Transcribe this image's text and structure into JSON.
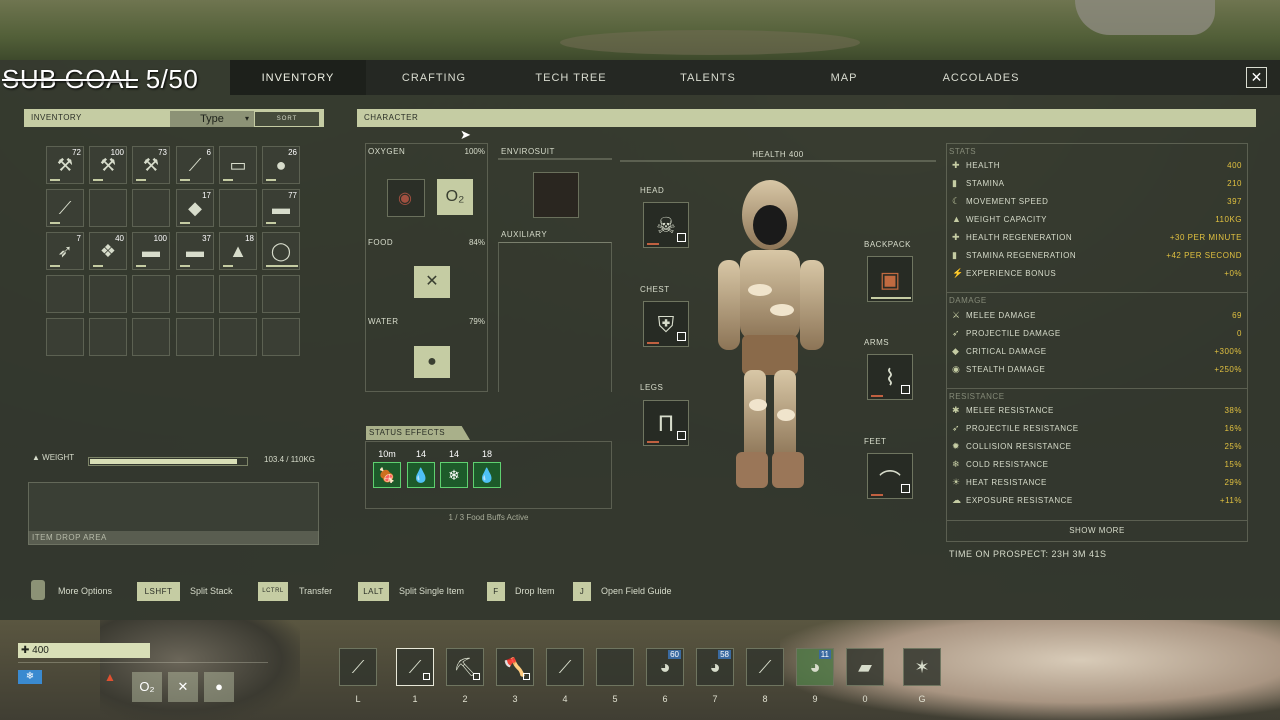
{
  "sub_goal": {
    "strike": "SUB GOAL",
    "progress": "5/50"
  },
  "tabs": [
    {
      "label": "Inventory",
      "active": true
    },
    {
      "label": "Crafting"
    },
    {
      "label": "Tech Tree"
    },
    {
      "label": "Talents"
    },
    {
      "label": "Map"
    },
    {
      "label": "Accolades"
    }
  ],
  "close_label": "✕",
  "inventory": {
    "header": "Inventory",
    "sort_value": "Type",
    "sort_button": "Sort",
    "slots": [
      {
        "icon": "bone-tool-icon",
        "glyph": "⚒",
        "count": "72"
      },
      {
        "icon": "bone-tool-icon",
        "glyph": "⚒",
        "count": "100"
      },
      {
        "icon": "bone-tool-icon",
        "glyph": "⚒",
        "count": "73"
      },
      {
        "icon": "stick-icon",
        "glyph": "⟋",
        "count": "6"
      },
      {
        "icon": "wood-plank-icon",
        "glyph": "▭",
        "count": ""
      },
      {
        "icon": "gold-ore-icon",
        "glyph": "●",
        "count": "26"
      },
      {
        "icon": "knife-icon",
        "glyph": "⟋",
        "count": ""
      },
      {
        "icon": "empty",
        "glyph": "",
        "count": ""
      },
      {
        "icon": "empty",
        "glyph": "",
        "count": ""
      },
      {
        "icon": "stone-icon",
        "glyph": "◆",
        "count": "17"
      },
      {
        "icon": "empty",
        "glyph": "",
        "count": ""
      },
      {
        "icon": "wood-icon",
        "glyph": "▬",
        "count": "77"
      },
      {
        "icon": "arrow-icon",
        "glyph": "➶",
        "count": "7"
      },
      {
        "icon": "crystal-icon",
        "glyph": "❖",
        "count": "40"
      },
      {
        "icon": "wood-stick-icon",
        "glyph": "▬",
        "count": "100"
      },
      {
        "icon": "wood-stick-icon",
        "glyph": "▬",
        "count": "37"
      },
      {
        "icon": "dirt-pile-icon",
        "glyph": "▲",
        "count": "18"
      },
      {
        "icon": "rope-ring-icon",
        "glyph": "◯",
        "count": ""
      }
    ],
    "weight_label": "Weight",
    "weight_value": "103.4 / 110KG",
    "weight_fraction": 0.94,
    "drop_area": "Item Drop Area"
  },
  "character": {
    "header": "Character",
    "oxygen": {
      "label": "Oxygen",
      "value": "100%",
      "o2": "O₂"
    },
    "food": {
      "label": "Food",
      "value": "84%"
    },
    "water": {
      "label": "Water",
      "value": "79%"
    },
    "envirosuit": "Envirosuit",
    "auxiliary": "Auxiliary",
    "health": "HEALTH 400",
    "slots": {
      "head": "Head",
      "chest": "Chest",
      "legs": "Legs",
      "backpack": "Backpack",
      "arms": "Arms",
      "feet": "Feet"
    },
    "status_effects": {
      "header": "Status Effects",
      "buffs": [
        {
          "time": "10m",
          "icon": "meat-icon",
          "glyph": "🍖"
        },
        {
          "time": "14",
          "icon": "water-drop-icon",
          "glyph": "💧"
        },
        {
          "time": "14",
          "icon": "snowflake-icon",
          "glyph": "❄"
        },
        {
          "time": "18",
          "icon": "drops-icon",
          "glyph": "💧"
        }
      ],
      "food_buffs": "1 / 3 Food Buffs Active"
    }
  },
  "stats": {
    "section": "Stats",
    "rows": [
      {
        "icon": "plus-icon",
        "glyph": "✚",
        "name": "Health",
        "value": "400"
      },
      {
        "icon": "stamina-icon",
        "glyph": "▮",
        "name": "Stamina",
        "value": "210"
      },
      {
        "icon": "speed-icon",
        "glyph": "☾",
        "name": "Movement Speed",
        "value": "397"
      },
      {
        "icon": "weight-icon",
        "glyph": "▲",
        "name": "Weight Capacity",
        "value": "110kg"
      },
      {
        "icon": "health-regen-icon",
        "glyph": "✚",
        "name": "Health Regeneration",
        "value": "+30 per minute"
      },
      {
        "icon": "stamina-regen-icon",
        "glyph": "▮",
        "name": "Stamina Regeneration",
        "value": "+42 per second"
      },
      {
        "icon": "xp-icon",
        "glyph": "⚡",
        "name": "Experience Bonus",
        "value": "+0%"
      }
    ],
    "damage_section": "Damage",
    "damage": [
      {
        "icon": "melee-icon",
        "glyph": "⚔",
        "name": "Melee Damage",
        "value": "69"
      },
      {
        "icon": "projectile-icon",
        "glyph": "➶",
        "name": "Projectile Damage",
        "value": "0"
      },
      {
        "icon": "critical-icon",
        "glyph": "◆",
        "name": "Critical Damage",
        "value": "+300%"
      },
      {
        "icon": "stealth-icon",
        "glyph": "◉",
        "name": "Stealth Damage",
        "value": "+250%"
      }
    ],
    "resistance_section": "Resistance",
    "resistance": [
      {
        "icon": "melee-res-icon",
        "glyph": "✱",
        "name": "Melee Resistance",
        "value": "38%"
      },
      {
        "icon": "projectile-res-icon",
        "glyph": "➶",
        "name": "Projectile Resistance",
        "value": "16%"
      },
      {
        "icon": "collision-res-icon",
        "glyph": "✹",
        "name": "Collision Resistance",
        "value": "25%"
      },
      {
        "icon": "cold-res-icon",
        "glyph": "❄",
        "name": "Cold Resistance",
        "value": "15%"
      },
      {
        "icon": "heat-res-icon",
        "glyph": "☀",
        "name": "Heat Resistance",
        "value": "29%"
      },
      {
        "icon": "exposure-res-icon",
        "glyph": "☁",
        "name": "Exposure Resistance",
        "value": "+11%"
      }
    ],
    "show_more": "Show More",
    "time_on_prospect": "TIME ON PROSPECT: 23H 3M 41S"
  },
  "hints": [
    {
      "key": "",
      "text": "More Options"
    },
    {
      "key": "LSHFT",
      "text": "Split Stack"
    },
    {
      "key": "LCTRL",
      "text": "Transfer"
    },
    {
      "key": "LALT",
      "text": "Split Single Item"
    },
    {
      "key": "F",
      "text": "Drop Item"
    },
    {
      "key": "J",
      "text": "Open Field Guide"
    }
  ],
  "hud": {
    "health": "400",
    "hotbar": [
      {
        "key": "L",
        "icon": "torch-icon",
        "glyph": "⟋",
        "count": ""
      },
      {
        "key": "1",
        "icon": "spear-icon",
        "glyph": "⟋",
        "count": ""
      },
      {
        "key": "2",
        "icon": "pickaxe-icon",
        "glyph": "⛏",
        "count": ""
      },
      {
        "key": "3",
        "icon": "axe-icon",
        "glyph": "🪓",
        "count": ""
      },
      {
        "key": "4",
        "icon": "knife-icon",
        "glyph": "⟋",
        "count": ""
      },
      {
        "key": "5",
        "icon": "empty",
        "glyph": "",
        "count": ""
      },
      {
        "key": "6",
        "icon": "pouch-icon",
        "glyph": "◕",
        "count": "60"
      },
      {
        "key": "7",
        "icon": "pouch-icon",
        "glyph": "◕",
        "count": "58"
      },
      {
        "key": "8",
        "icon": "shovel-icon",
        "glyph": "⟋",
        "count": ""
      },
      {
        "key": "9",
        "icon": "meat-icon",
        "glyph": "◕",
        "count": "11"
      },
      {
        "key": "0",
        "icon": "canteen-icon",
        "glyph": "▰",
        "count": ""
      },
      {
        "key": "G",
        "icon": "grapple-icon",
        "glyph": "✶",
        "count": ""
      }
    ]
  }
}
